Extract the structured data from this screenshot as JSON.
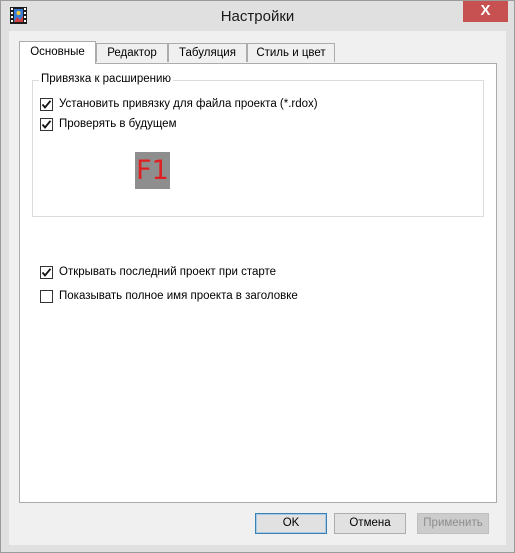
{
  "window": {
    "title": "Настройки",
    "close_label": "X",
    "app_icon": "film-strip-icon"
  },
  "tabs": [
    {
      "label": "Основные",
      "active": true
    },
    {
      "label": "Редактор",
      "active": false
    },
    {
      "label": "Табуляция",
      "active": false
    },
    {
      "label": "Стиль и цвет",
      "active": false
    }
  ],
  "group": {
    "title": "Привязка к расширению",
    "items": [
      {
        "label": "Установить привязку для файла проекта (*.rdox)",
        "checked": true
      },
      {
        "label": "Проверять в будущем",
        "checked": true
      }
    ],
    "badge": "F1"
  },
  "options": [
    {
      "label": "Открывать последний проект при старте",
      "checked": true
    },
    {
      "label": "Показывать полное имя проекта в заголовке",
      "checked": false
    }
  ],
  "buttons": {
    "ok": "OK",
    "cancel": "Отмена",
    "apply": "Применить"
  }
}
